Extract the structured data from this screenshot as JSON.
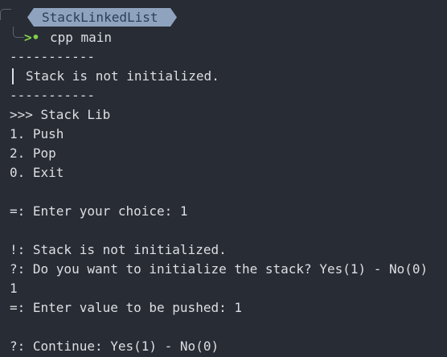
{
  "prompt": {
    "directory": "StackLinkedList",
    "arrow_glyph": ">•",
    "command": "cpp main",
    "pill_color": "#8fa3bf"
  },
  "output": {
    "separator_top": "-----------",
    "status_message": "Stack is not initialized.",
    "separator_bottom": "-----------",
    "menu_title": ">>> Stack Lib",
    "menu_push": "1. Push",
    "menu_pop": "2. Pop",
    "menu_exit": "0. Exit",
    "choice_prompt": "=: Enter your choice: 1",
    "warning": "!: Stack is not initialized.",
    "init_question": "?: Do you want to initialize the stack? Yes(1) - No(0)",
    "init_answer": "1",
    "value_prompt": "=: Enter value to be pushed: 1",
    "continue_question": "?: Continue: Yes(1) - No(0)"
  }
}
